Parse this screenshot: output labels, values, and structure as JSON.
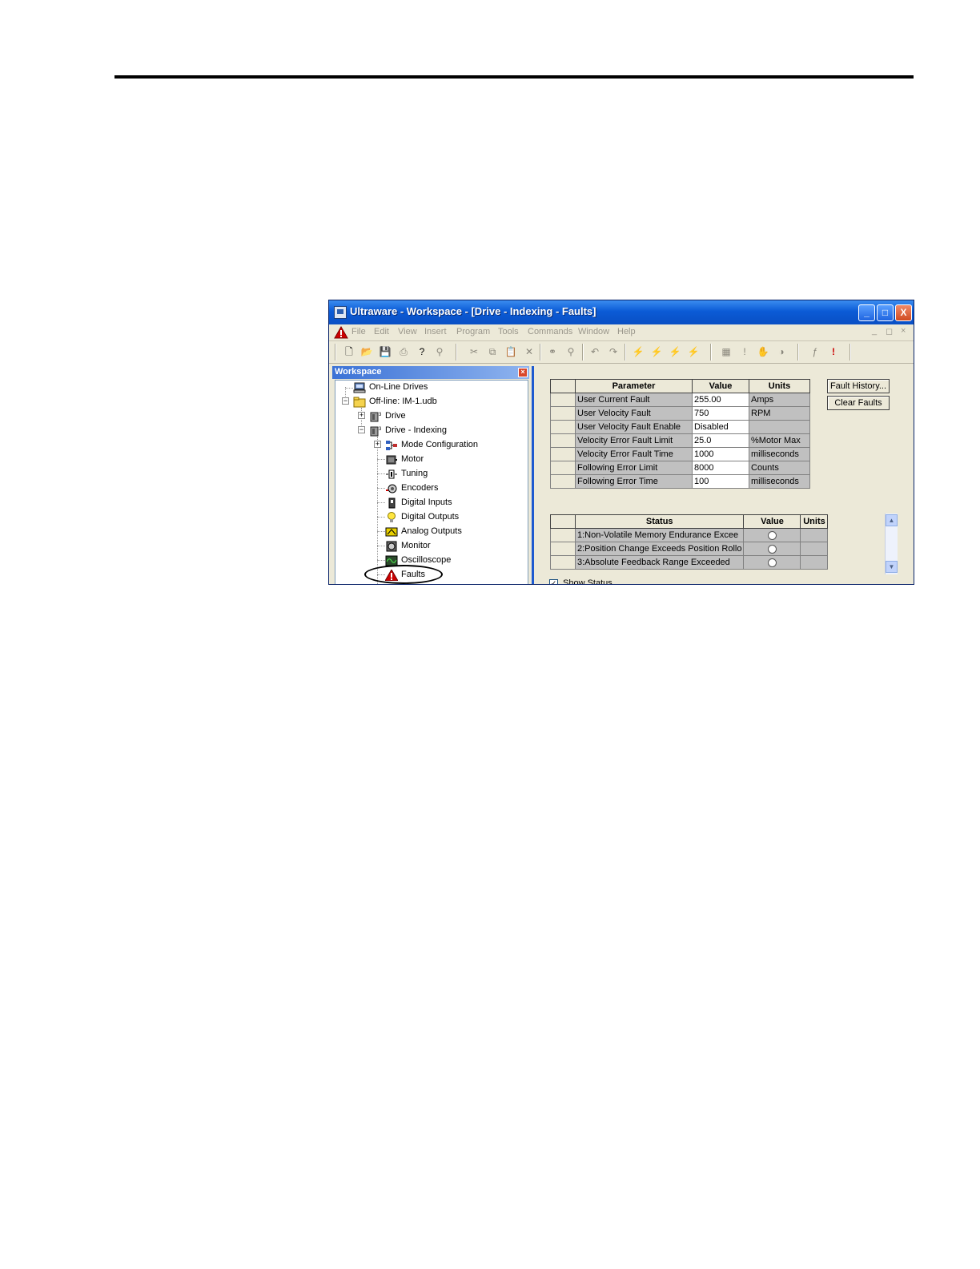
{
  "window": {
    "title": "Ultraware - Workspace - [Drive - Indexing - Faults]",
    "controls": {
      "minimize": "_",
      "maximize": "□",
      "close": "X"
    }
  },
  "menu": {
    "items": [
      "File",
      "Edit",
      "View",
      "Insert",
      "Program",
      "Tools",
      "Commands",
      "Window",
      "Help"
    ],
    "mdi_controls": [
      "_",
      "◻",
      "×"
    ]
  },
  "toolbar": {
    "icons": [
      "new-icon",
      "open-icon",
      "save-icon",
      "print-icon",
      "help-icon",
      "context-help-icon",
      "cut-icon",
      "copy-icon",
      "paste-icon",
      "delete-icon",
      "find-icon",
      "find-replace-icon",
      "undo-icon",
      "redo-icon",
      "connect-icon",
      "upload-icon",
      "download-icon",
      "disconnect-icon",
      "grid-icon",
      "alert-icon",
      "stop-icon",
      "compare-icon",
      "function-icon",
      "fault-reset-icon"
    ]
  },
  "workspace": {
    "title": "Workspace",
    "close": "×",
    "tree": {
      "online": "On-Line Drives",
      "offline": "Off-line: IM-1.udb",
      "drive": "Drive",
      "drive_indexing": "Drive - Indexing",
      "children": [
        "Mode Configuration",
        "Motor",
        "Tuning",
        "Encoders",
        "Digital Inputs",
        "Digital Outputs",
        "Analog Outputs",
        "Monitor",
        "Oscilloscope",
        "Faults"
      ]
    }
  },
  "params": {
    "headers": [
      "Parameter",
      "Value",
      "Units"
    ],
    "rows": [
      {
        "name": "User Current Fault",
        "value": "255.00",
        "units": "Amps"
      },
      {
        "name": "User Velocity Fault",
        "value": "750",
        "units": "RPM"
      },
      {
        "name": "User Velocity Fault Enable",
        "value": "Disabled",
        "units": ""
      },
      {
        "name": "Velocity Error Fault Limit",
        "value": "25.0",
        "units": "%Motor Max"
      },
      {
        "name": "Velocity Error Fault Time",
        "value": "1000",
        "units": "milliseconds"
      },
      {
        "name": "Following Error Limit",
        "value": "8000",
        "units": "Counts"
      },
      {
        "name": "Following Error Time",
        "value": "100",
        "units": "milliseconds"
      }
    ]
  },
  "buttons": {
    "fault_history": "Fault History...",
    "clear_faults": "Clear Faults"
  },
  "status": {
    "headers": [
      "Status",
      "Value",
      "Units"
    ],
    "rows": [
      "1:Non-Volatile Memory Endurance Excee",
      "2:Position Change Exceeds Position Rollo",
      "3:Absolute Feedback Range Exceeded"
    ]
  },
  "show_status": {
    "label": "Show Status",
    "checked": true
  },
  "colors": {
    "title_bar": "#0b5bd6",
    "workspace_bar": "#3b72d6",
    "warning_red": "#cc0000"
  }
}
